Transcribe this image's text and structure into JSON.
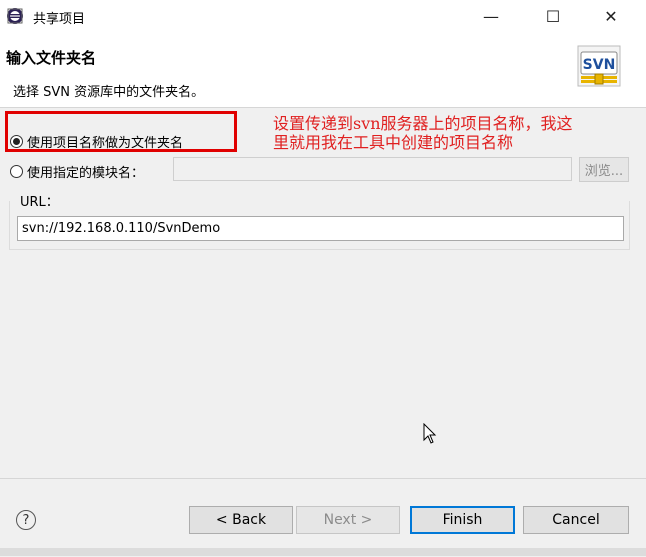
{
  "window": {
    "title": "共享项目",
    "controls": {
      "minimize": "—",
      "maximize": "☐",
      "close": "✕"
    }
  },
  "header": {
    "title": "输入文件夹名",
    "description": "选择 SVN 资源库中的文件夹名。",
    "logo_text": "SVN"
  },
  "options": {
    "use_project_name_label": "使用项目名称做为文件夹名",
    "use_project_name_selected": true,
    "use_module_name_label": "使用指定的模块名：",
    "module_name_value": "",
    "browse_label": "浏览..."
  },
  "annotation": {
    "line1": "设置传递到svn服务器上的项目名称，我这",
    "line2": "里就用我在工具中创建的项目名称",
    "color": "#e02020"
  },
  "url": {
    "label": "URL：",
    "value": "svn://192.168.0.110/SvnDemo"
  },
  "footer": {
    "help_icon": "?",
    "back_label": "< Back",
    "next_label": "Next >",
    "finish_label": "Finish",
    "cancel_label": "Cancel"
  },
  "colors": {
    "accent": "#0078d7",
    "highlight_box": "#e00000"
  }
}
